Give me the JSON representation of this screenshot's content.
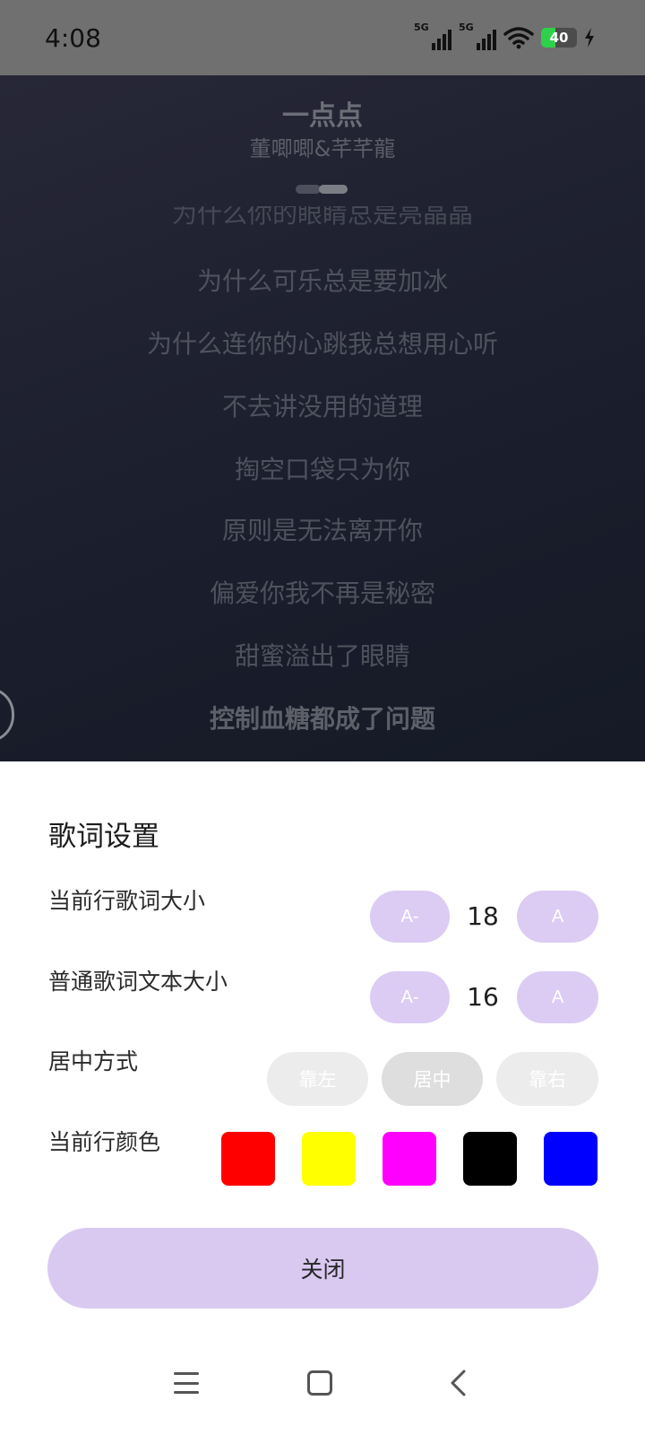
{
  "status": {
    "time": "4:08",
    "signal1_label": "5G",
    "signal2_label": "5G",
    "battery_level": "40",
    "battery_fraction": 0.4
  },
  "player": {
    "title": "一点点",
    "artist": "董唧唧&芊芊龍",
    "lyrics": [
      "为什么你的眼睛总是亮晶晶",
      "为什么可乐总是要加冰",
      "为什么连你的心跳我总想用心听",
      "不去讲没用的道理",
      "掏空口袋只为你",
      "原则是无法离开你",
      "偏爱你我不再是秘密",
      "甜蜜溢出了眼睛",
      "控制血糖都成了问题"
    ]
  },
  "sheet": {
    "title": "歌词设置",
    "current_size": {
      "label": "当前行歌词大小",
      "decrease": "A-",
      "value": "18",
      "increase": "A"
    },
    "normal_size": {
      "label": "普通歌词文本大小",
      "decrease": "A-",
      "value": "16",
      "increase": "A"
    },
    "alignment": {
      "label": "居中方式",
      "options": [
        "靠左",
        "居中",
        "靠右"
      ],
      "selected": "居中"
    },
    "color": {
      "label": "当前行颜色",
      "swatches": [
        "#ff0000",
        "#ffff00",
        "#ff00ff",
        "#000000",
        "#0000ff"
      ]
    },
    "close_label": "关闭"
  },
  "icons": {
    "nav_menu": "menu-icon",
    "nav_home": "home-icon",
    "nav_back": "back-icon",
    "battery": "battery-icon",
    "wifi": "wifi-icon",
    "charging": "charging-icon"
  }
}
